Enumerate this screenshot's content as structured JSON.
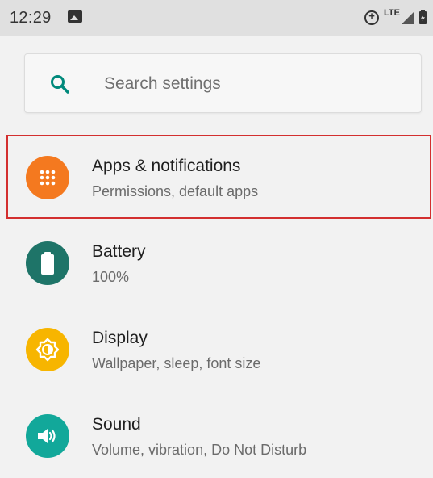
{
  "status_bar": {
    "time": "12:29",
    "network": "LTE",
    "icons": [
      "image-icon",
      "data-saver-icon",
      "signal-icon",
      "battery-charging-icon"
    ]
  },
  "search": {
    "placeholder": "Search settings",
    "icon": "search-icon",
    "accent": "#00897b"
  },
  "settings": [
    {
      "id": "apps",
      "title": "Apps & notifications",
      "subtitle": "Permissions, default apps",
      "icon": "apps-grid-icon",
      "color": "#f4791f",
      "selected": true
    },
    {
      "id": "battery",
      "title": "Battery",
      "subtitle": "100%",
      "icon": "battery-icon",
      "color": "#1e7468"
    },
    {
      "id": "display",
      "title": "Display",
      "subtitle": "Wallpaper, sleep, font size",
      "icon": "brightness-icon",
      "color": "#f7b500"
    },
    {
      "id": "sound",
      "title": "Sound",
      "subtitle": "Volume, vibration, Do Not Disturb",
      "icon": "volume-icon",
      "color": "#12a89a"
    }
  ],
  "highlight_color": "#d32f2f"
}
